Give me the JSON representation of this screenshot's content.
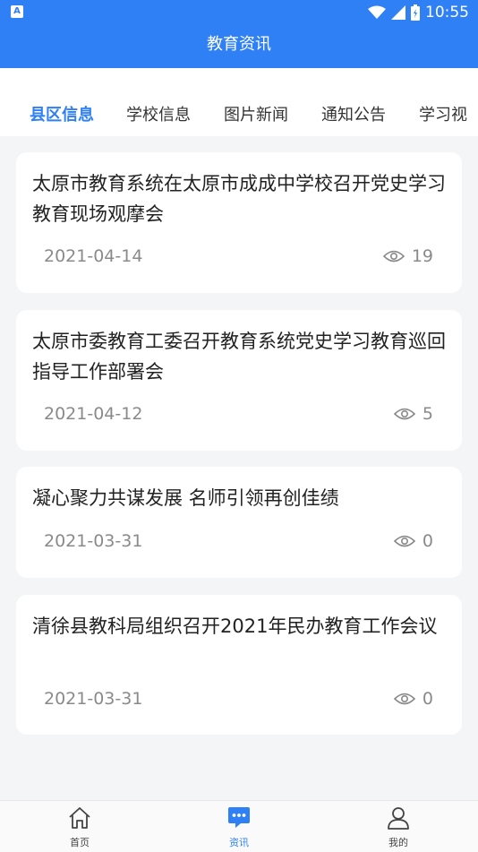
{
  "status_bar": {
    "time": "10:55",
    "left_icon_letter": "A"
  },
  "header": {
    "title": "教育资讯"
  },
  "tabs": [
    {
      "label": "县区信息",
      "active": true
    },
    {
      "label": "学校信息",
      "active": false
    },
    {
      "label": "图片新闻",
      "active": false
    },
    {
      "label": "通知公告",
      "active": false
    },
    {
      "label": "学习视",
      "active": false
    }
  ],
  "articles": [
    {
      "title": "太原市教育系统在太原市成成中学校召开党史学习教育现场观摩会",
      "date": "2021-04-14",
      "views": "19"
    },
    {
      "title": "太原市委教育工委召开教育系统党史学习教育巡回指导工作部署会",
      "date": "2021-04-12",
      "views": "5"
    },
    {
      "title": "凝心聚力共谋发展 名师引领再创佳绩",
      "date": "2021-03-31",
      "views": "0"
    },
    {
      "title": "清徐县教科局组织召开2021年民办教育工作会议",
      "date": "2021-03-31",
      "views": "0"
    }
  ],
  "bottom_nav": [
    {
      "label": "首页",
      "icon": "home-icon",
      "active": false
    },
    {
      "label": "资讯",
      "icon": "chat-icon",
      "active": true
    },
    {
      "label": "我的",
      "icon": "user-icon",
      "active": false
    }
  ],
  "colors": {
    "accent": "#2f80f5",
    "background": "#f4f5f7"
  }
}
